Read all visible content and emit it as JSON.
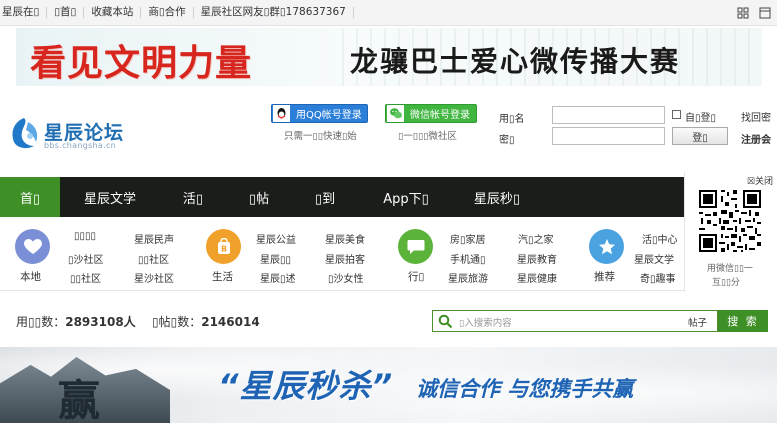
{
  "topbar": {
    "links": [
      "星辰在\u0000",
      "\u0000首\u0000",
      "收藏本站",
      "商\u0000合作",
      "星辰社区网友\u0000群\u0000178637367"
    ],
    "right_icons": [
      "grid-icon",
      "window-icon"
    ]
  },
  "banner_top": {
    "red_text": "看见文明力量",
    "black_text": "龙骧巴士爱心微传播大赛"
  },
  "logo": {
    "name": "星辰论坛",
    "url": "bbs.changsha.cn"
  },
  "social_login": {
    "qq_label": "用QQ帐号登录",
    "qq_note": "只需一\u0000\u0000快速\u0000始",
    "wechat_label": "微信帐号登录",
    "wechat_note": "\u0000一\u0000\u0000\u0000微社区"
  },
  "login": {
    "username_label": "用\u0000名",
    "password_label": "密\u0000",
    "remember_label": "自\u0000登\u0000",
    "find_password": "找回密",
    "login_button": "登\u0000",
    "register": "注册会"
  },
  "nav": {
    "items": [
      "首\u0000",
      "星辰文学",
      "活\u0000",
      "\u0000帖",
      "\u0000到",
      "App下\u0000",
      "星辰秒\u0000"
    ],
    "active_index": 0
  },
  "qr": {
    "close": "关闭",
    "caption1": "用微信\u0000\u0000一",
    "caption2": "互\u0000\u0000分"
  },
  "categories": [
    {
      "name": "本地",
      "color": "#7b8fd6",
      "icon": "heart-icon",
      "links": [
        "\u0000\u0000\u0000\u0000",
        "星辰民声",
        "\u0000沙社区",
        "\u0000\u0000社区",
        "\u0000\u0000社区",
        "星沙社区"
      ]
    },
    {
      "name": "生活",
      "color": "#f0a12b",
      "icon": "bag-icon",
      "links": [
        "星辰公益",
        "星辰美食",
        "星辰\u0000\u0000",
        "星辰拍客",
        "星辰\u0000述",
        "\u0000沙女性"
      ]
    },
    {
      "name": "行\u0000",
      "color": "#5bb33a",
      "icon": "chat-icon",
      "links": [
        "房\u0000家居",
        "汽\u0000之家",
        "手机通\u0000",
        "星辰教育",
        "星辰旅游",
        "星辰健康"
      ]
    },
    {
      "name": "推荐",
      "color": "#4aa3e0",
      "icon": "star-icon",
      "links": [
        "活\u0000中心",
        "星辰文学",
        "\u0000\u0000\u0000\u0000",
        "奇\u0000趣事"
      ]
    }
  ],
  "stats": {
    "users_label": "用\u0000\u0000数：",
    "users_value": "2893108人",
    "posts_label": "\u0000帖\u0000数：",
    "posts_value": "2146014"
  },
  "search": {
    "placeholder": "\u0000入搜索内容",
    "scope": "帖子",
    "button": "搜 索"
  },
  "banner_bottom": {
    "ying": "赢",
    "slogan_main": "“星辰秒杀”",
    "slogan_sub": "诚信合作 与您携手共赢"
  }
}
